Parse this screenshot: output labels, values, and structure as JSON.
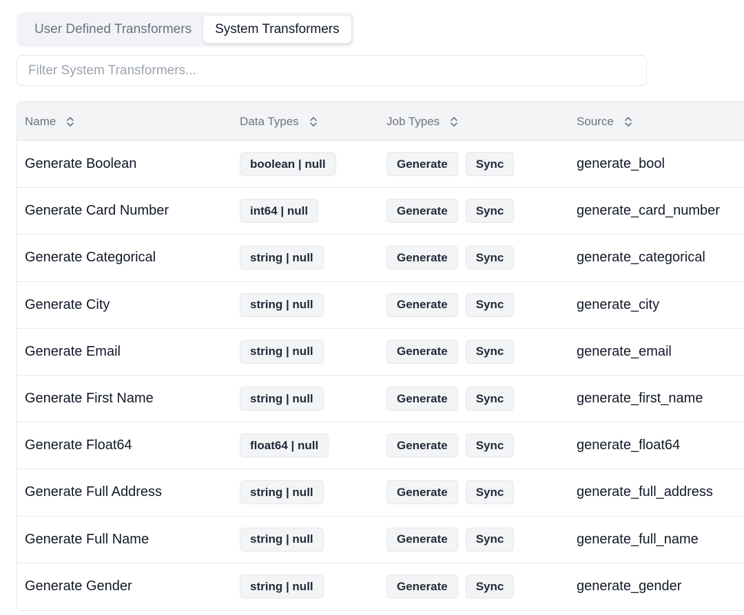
{
  "tabs": [
    {
      "label": "User Defined Transformers",
      "active": false
    },
    {
      "label": "System Transformers",
      "active": true
    }
  ],
  "filter": {
    "placeholder": "Filter System Transformers...",
    "value": ""
  },
  "table": {
    "columns": [
      "Name",
      "Data Types",
      "Job Types",
      "Source"
    ],
    "rows": [
      {
        "name": "Generate Boolean",
        "data_type": "boolean | null",
        "job_types": [
          "Generate",
          "Sync"
        ],
        "source": "generate_bool"
      },
      {
        "name": "Generate Card Number",
        "data_type": "int64 | null",
        "job_types": [
          "Generate",
          "Sync"
        ],
        "source": "generate_card_number"
      },
      {
        "name": "Generate Categorical",
        "data_type": "string | null",
        "job_types": [
          "Generate",
          "Sync"
        ],
        "source": "generate_categorical"
      },
      {
        "name": "Generate City",
        "data_type": "string | null",
        "job_types": [
          "Generate",
          "Sync"
        ],
        "source": "generate_city"
      },
      {
        "name": "Generate Email",
        "data_type": "string | null",
        "job_types": [
          "Generate",
          "Sync"
        ],
        "source": "generate_email"
      },
      {
        "name": "Generate First Name",
        "data_type": "string | null",
        "job_types": [
          "Generate",
          "Sync"
        ],
        "source": "generate_first_name"
      },
      {
        "name": "Generate Float64",
        "data_type": "float64 | null",
        "job_types": [
          "Generate",
          "Sync"
        ],
        "source": "generate_float64"
      },
      {
        "name": "Generate Full Address",
        "data_type": "string | null",
        "job_types": [
          "Generate",
          "Sync"
        ],
        "source": "generate_full_address"
      },
      {
        "name": "Generate Full Name",
        "data_type": "string | null",
        "job_types": [
          "Generate",
          "Sync"
        ],
        "source": "generate_full_name"
      },
      {
        "name": "Generate Gender",
        "data_type": "string | null",
        "job_types": [
          "Generate",
          "Sync"
        ],
        "source": "generate_gender"
      }
    ]
  },
  "icons": {
    "sort": "sort-updown-icon"
  }
}
